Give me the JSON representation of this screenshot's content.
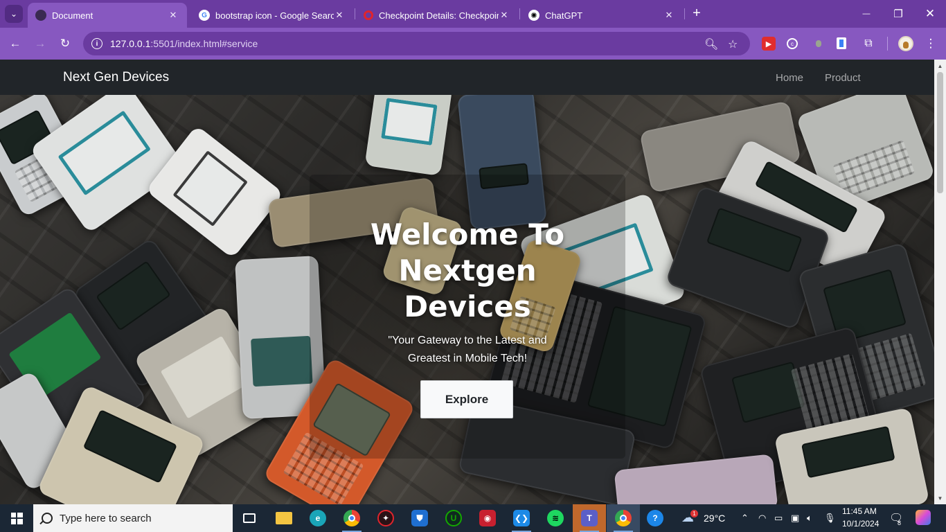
{
  "browser": {
    "tabs": [
      {
        "title": "Document",
        "active": true
      },
      {
        "title": "bootstrap icon - Google Search",
        "active": false
      },
      {
        "title": "Checkpoint Details: Checkpoint",
        "active": false
      },
      {
        "title": "ChatGPT",
        "active": false
      }
    ],
    "tab_close": "✕",
    "new_tab": "+",
    "window": {
      "minimize": "—",
      "restore": "❐",
      "close": "✕"
    },
    "url_host": "127.0.0.1",
    "url_rest": ":5501/index.html#service",
    "accent": "#8758c0",
    "tabbar_color": "#6a3ba0"
  },
  "site": {
    "brand": "Next Gen Devices",
    "nav": [
      "Home",
      "Product"
    ],
    "hero": {
      "title": "Welcome To Nextgen Devices",
      "subtitle": "\"Your Gateway to the Latest and Greatest in Mobile Tech!",
      "button": "Explore"
    }
  },
  "taskbar": {
    "search_placeholder": "Type here to search",
    "apps": [
      "task-view",
      "file-explorer",
      "edge",
      "chrome",
      "app-red",
      "app-shield",
      "app-upwork",
      "app-recorder",
      "vscode",
      "spotify",
      "teams",
      "chrome-active",
      "help"
    ],
    "weather": "29°C",
    "weather_badge": "1",
    "time": "11:45 AM",
    "date": "10/1/2024",
    "notifications": "8"
  }
}
